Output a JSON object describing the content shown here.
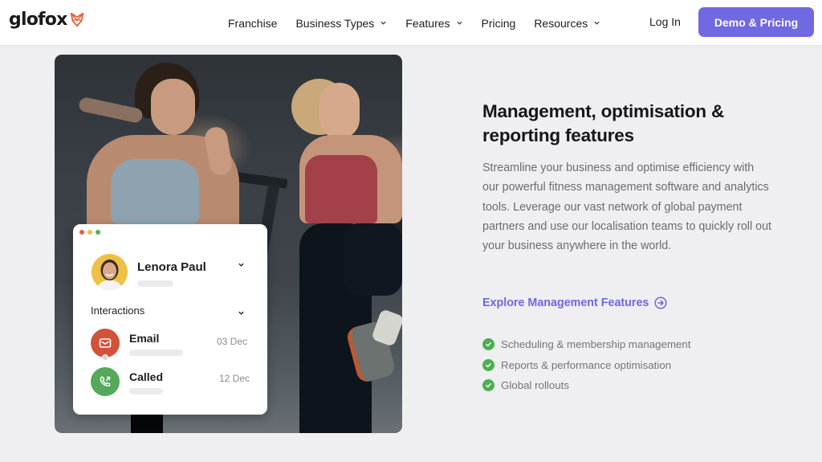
{
  "header": {
    "logo_text": "glofox",
    "logo_icon": "fox-icon",
    "nav": [
      {
        "label": "Franchise",
        "has_dropdown": false
      },
      {
        "label": "Business Types",
        "has_dropdown": true
      },
      {
        "label": "Features",
        "has_dropdown": true
      },
      {
        "label": "Pricing",
        "has_dropdown": false
      },
      {
        "label": "Resources",
        "has_dropdown": true
      }
    ],
    "login_label": "Log In",
    "cta_label": "Demo & Pricing"
  },
  "colors": {
    "brand_accent": "#7069e2",
    "logo_orange": "#e8603c",
    "check_green": "#4caf50",
    "email_red": "#d2523a",
    "call_green": "#56a85a",
    "avatar_yellow": "#eec043",
    "window_dots": [
      "#e85d45",
      "#eec043",
      "#55b25a"
    ]
  },
  "hero_image": {
    "description": "Two women exercising in a gym"
  },
  "crm_card": {
    "contact_name": "Lenora Paul",
    "section_label": "Interactions",
    "interactions": [
      {
        "type": "Email",
        "icon": "mail-icon",
        "date": "03 Dec"
      },
      {
        "type": "Called",
        "icon": "phone-call-icon",
        "date": "12 Dec"
      }
    ]
  },
  "content": {
    "heading": "Management, optimisation & reporting features",
    "description": "Streamline your business and optimise efficiency with our powerful fitness management software and analytics tools. Leverage our vast network of global payment partners and use our localisation teams to quickly roll out your business anywhere in the world.",
    "cta_link": "Explore Management Features",
    "features": [
      "Scheduling & membership management",
      "Reports & performance optimisation",
      "Global rollouts"
    ]
  }
}
